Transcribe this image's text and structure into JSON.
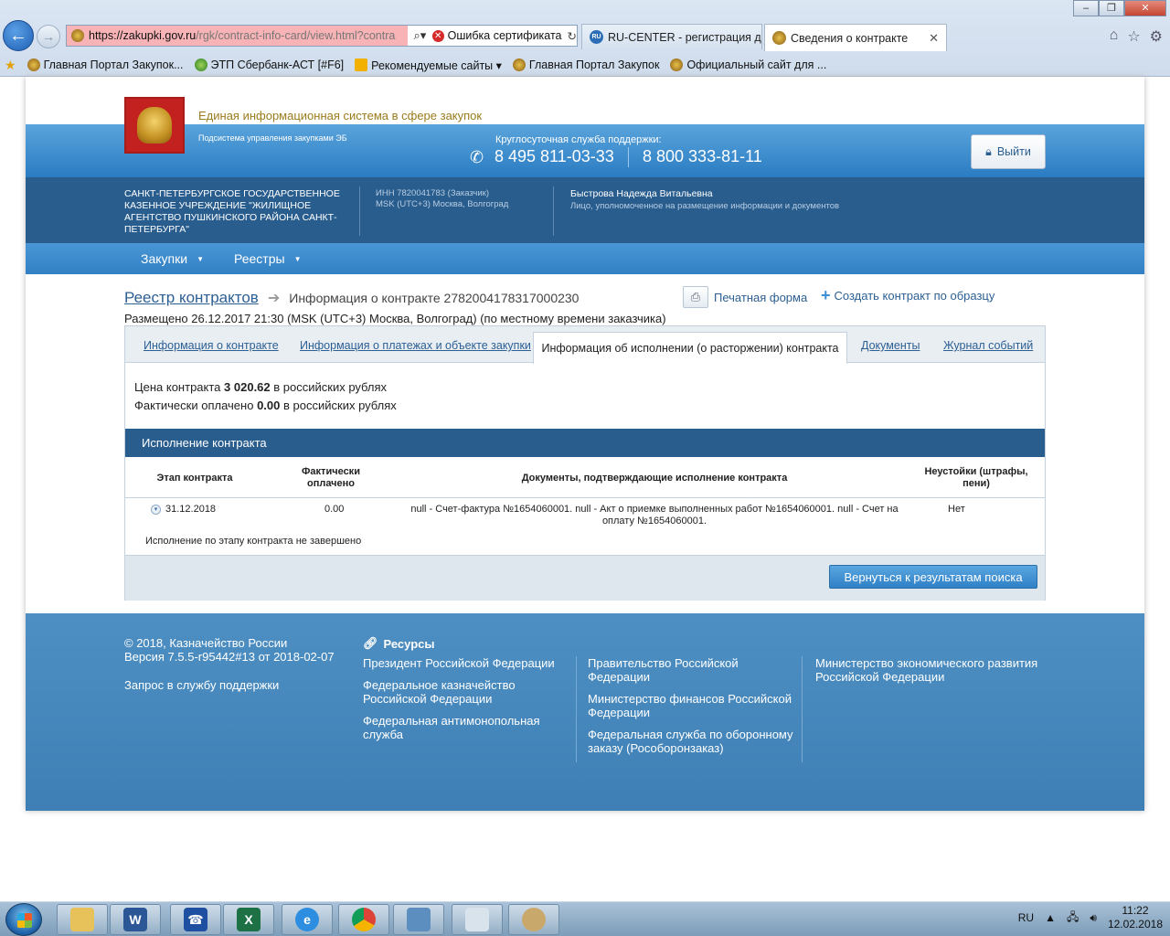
{
  "browser": {
    "url_host": "https://zakupki.gov.ru",
    "url_path": "/rgk/contract-info-card/view.html?contra",
    "cert_error": "Ошибка сертификата",
    "tabs": [
      {
        "label": "RU-CENTER - регистрация до..."
      },
      {
        "label": "Сведения о контракте"
      }
    ],
    "favorites": [
      {
        "label": "Главная Портал Закупок..."
      },
      {
        "label": "ЭТП Сбербанк-АСТ [#F6]"
      },
      {
        "label": "Рекомендуемые сайты ▾"
      },
      {
        "label": "Главная Портал Закупок"
      },
      {
        "label": "Официальный сайт для ..."
      }
    ],
    "favicon_tab_ru": "RU"
  },
  "header": {
    "site_name": "Единая информационная система в сфере закупок",
    "subsystem": "Подсистема управления закупками ЭБ",
    "support_label": "Круглосуточная служба поддержки:",
    "phone1": "8 495 811-03-33",
    "phone2": "8 800 333-81-11",
    "logout": "Выйти"
  },
  "org": {
    "name": "САНКТ-ПЕТЕРБУРГСКОЕ ГОСУДАРСТВЕННОЕ КАЗЕННОЕ УЧРЕЖДЕНИЕ \"ЖИЛИЩНОЕ АГЕНТСТВО ПУШКИНСКОГО РАЙОНА САНКТ-ПЕТЕРБУРГА\"",
    "inn": "ИНН 7820041783 (Заказчик)",
    "timezone": "MSK (UTC+3) Москва, Волгоград",
    "user_name": "Быстрова Надежда Витальевна",
    "user_role": "Лицо, уполномоченное на размещение информации и документов"
  },
  "menu": [
    {
      "label": "Закупки"
    },
    {
      "label": "Реестры"
    }
  ],
  "page": {
    "breadcrumb_link": "Реестр контрактов",
    "breadcrumb_current": "Информация о контракте 2782004178317000230",
    "print_form": "Печатная форма",
    "create_copy": "Создать контракт по образцу",
    "placed": "Размещено 26.12.2017 21:30 (MSK (UTC+3) Москва, Волгоград) (по местному времени заказчика)"
  },
  "tabs": [
    {
      "label": "Информация о контракте"
    },
    {
      "label": "Информация о платежах и объекте закупки"
    },
    {
      "label": "Информация об исполнении (о расторжении) контракта"
    },
    {
      "label": "Документы"
    },
    {
      "label": "Журнал событий"
    }
  ],
  "summary": {
    "price_prefix": "Цена контракта",
    "price_value": "3 020.62",
    "price_suffix": "в российских рублях",
    "paid_prefix": "Фактически оплачено",
    "paid_value": "0.00",
    "paid_suffix": "в российских рублях"
  },
  "execution": {
    "title": "Исполнение контракта",
    "columns": {
      "stage": "Этап контракта",
      "paid": "Фактически оплачено",
      "docs": "Документы, подтверждающие исполнение контракта",
      "penalties": "Неустойки (штрафы, пени)"
    },
    "rows": [
      {
        "date": "31.12.2018",
        "paid": "0.00",
        "docs": "null - Счет-фактура №1654060001. null - Акт о приемке выполненных работ №1654060001. null - Счет на оплату №1654060001.",
        "penalties": "Нет"
      }
    ],
    "stage_status": "Исполнение по этапу контракта не завершено",
    "back_button": "Вернуться к результатам поиска"
  },
  "footer": {
    "copyright": "© 2018, Казначейство России",
    "version": "Версия 7.5.5-r95442#13 от 2018-02-07",
    "support_request": "Запрос в службу поддержки",
    "resources_title": "Ресурсы",
    "links": [
      "Президент Российской Федерации",
      "Федеральное казначейство Российской Федерации",
      "Федеральная антимонопольная служба",
      "Правительство Российской Федерации",
      "Министерство финансов Российской Федерации",
      "Федеральная служба по оборонному заказу (Рособоронзаказ)",
      "Министерство экономического развития Российской Федерации"
    ]
  },
  "taskbar": {
    "lang": "RU",
    "time": "11:22",
    "date": "12.02.2018"
  },
  "colors": {
    "header_blue": "#2a7cc2",
    "header_dark": "#295d8e",
    "link": "#2c5f93",
    "footer": "#4a8bc0"
  }
}
